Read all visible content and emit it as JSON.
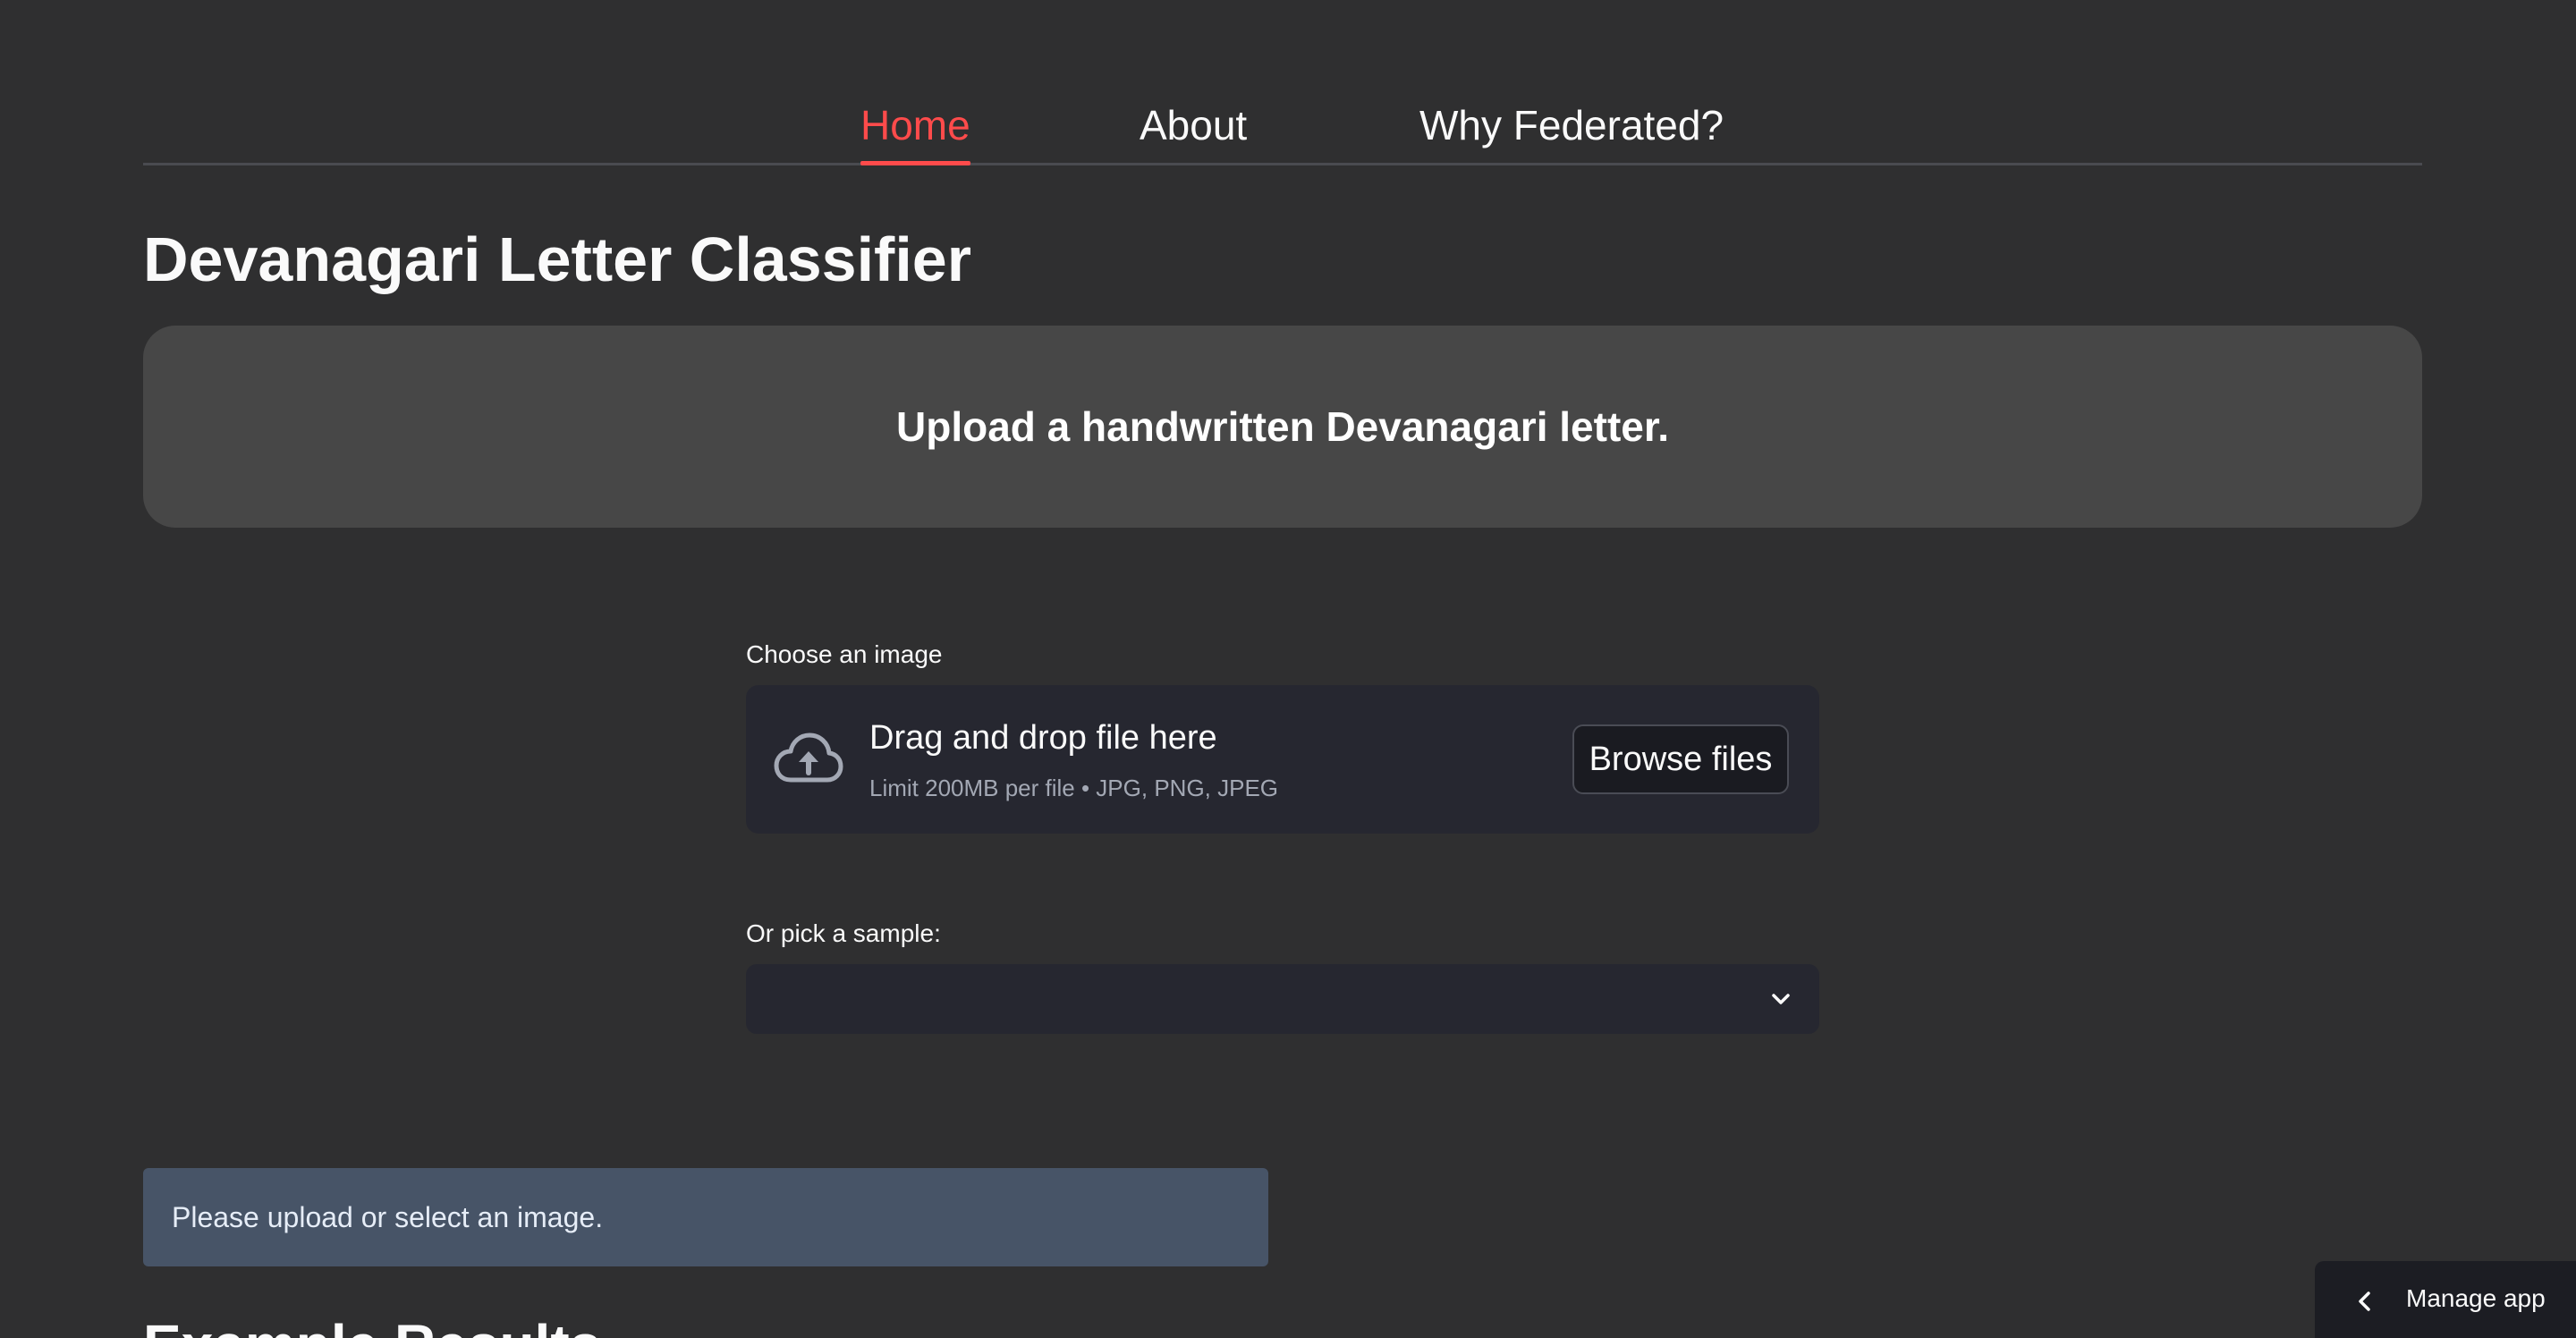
{
  "tabs": [
    {
      "label": "Home",
      "active": true
    },
    {
      "label": "About",
      "active": false
    },
    {
      "label": "Why Federated?",
      "active": false
    }
  ],
  "page_title": "Devanagari Letter Classifier",
  "banner": {
    "text": "Upload a handwritten Devanagari letter."
  },
  "uploader": {
    "label": "Choose an image",
    "drop_text": "Drag and drop file here",
    "limit_text": "Limit 200MB per file • JPG, PNG, JPEG",
    "browse_label": "Browse files",
    "icon": "cloud-upload-icon"
  },
  "sample_select": {
    "label": "Or pick a sample:",
    "selected_value": "",
    "icon": "chevron-down-icon"
  },
  "alert": {
    "text": "Please upload or select an image."
  },
  "section_heading": "Example Results",
  "manage_app": {
    "label": "Manage app",
    "icon": "chevron-left-icon"
  },
  "colors": {
    "background": "#2f2f30",
    "accent": "#ff4b4b",
    "banner_bg": "#474747",
    "widget_bg": "#262730",
    "alert_bg": "#475467"
  }
}
